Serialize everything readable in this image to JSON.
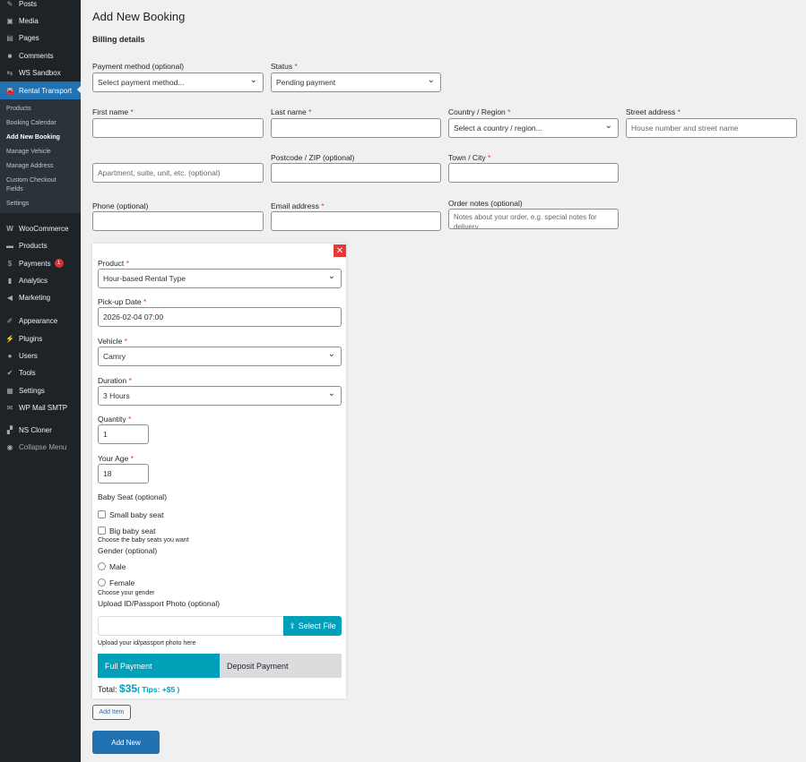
{
  "sidebar": {
    "items": [
      {
        "label": "Posts",
        "icon": "pin-icon"
      },
      {
        "label": "Media",
        "icon": "media-icon"
      },
      {
        "label": "Pages",
        "icon": "pages-icon"
      },
      {
        "label": "Comments",
        "icon": "comment-icon"
      },
      {
        "label": "WS Sandbox",
        "icon": "sandbox-icon"
      },
      {
        "label": "Rental Transport",
        "icon": "car-icon"
      }
    ],
    "submenu": [
      "Products",
      "Booking Calendar",
      "Add New Booking",
      "Manage Vehicle",
      "Manage Address",
      "Custom Checkout Fields",
      "Settings"
    ],
    "items2": [
      {
        "label": "WooCommerce",
        "icon": "woo-icon"
      },
      {
        "label": "Products",
        "icon": "archive-icon"
      },
      {
        "label": "Payments",
        "icon": "dollar-icon",
        "badge": "1"
      },
      {
        "label": "Analytics",
        "icon": "chart-icon"
      },
      {
        "label": "Marketing",
        "icon": "megaphone-icon"
      },
      {
        "label": "Appearance",
        "icon": "brush-icon"
      },
      {
        "label": "Plugins",
        "icon": "plugin-icon"
      },
      {
        "label": "Users",
        "icon": "user-icon"
      },
      {
        "label": "Tools",
        "icon": "wrench-icon"
      },
      {
        "label": "Settings",
        "icon": "settings-icon"
      },
      {
        "label": "WP Mail SMTP",
        "icon": "mail-icon"
      },
      {
        "label": "NS Cloner",
        "icon": "cloner-icon"
      },
      {
        "label": "Collapse Menu",
        "icon": "collapse-icon"
      }
    ]
  },
  "page": {
    "title": "Add New Booking",
    "section": "Billing details"
  },
  "billing": {
    "payment_method": {
      "label": "Payment method (optional)",
      "value": "Select payment method..."
    },
    "status": {
      "label": "Status",
      "value": "Pending payment"
    },
    "first_name": {
      "label": "First name"
    },
    "last_name": {
      "label": "Last name"
    },
    "country": {
      "label": "Country / Region",
      "value": "Select a country / region..."
    },
    "street": {
      "label": "Street address",
      "placeholder": "House number and street name"
    },
    "apartment": {
      "placeholder": "Apartment, suite, unit, etc. (optional)"
    },
    "postcode": {
      "label": "Postcode / ZIP (optional)"
    },
    "city": {
      "label": "Town / City"
    },
    "phone": {
      "label": "Phone (optional)"
    },
    "email": {
      "label": "Email address"
    },
    "notes": {
      "label": "Order notes (optional)",
      "placeholder": "Notes about your order, e.g. special notes for delivery."
    }
  },
  "item": {
    "product": {
      "label": "Product",
      "value": "Hour-based Rental Type"
    },
    "pickup": {
      "label": "Pick-up Date",
      "value": "2026-02-04 07:00"
    },
    "vehicle": {
      "label": "Vehicle",
      "value": "Camry"
    },
    "duration": {
      "label": "Duration",
      "value": "3 Hours"
    },
    "quantity": {
      "label": "Quantity",
      "value": "1"
    },
    "age": {
      "label": "Your Age",
      "value": "18"
    },
    "baby_seat": {
      "label": "Baby Seat (optional)",
      "options": [
        "Small baby seat",
        "Big baby seat"
      ],
      "help": "Choose the baby seats you want"
    },
    "gender": {
      "label": "Gender (optional)",
      "options": [
        "Male",
        "Female"
      ],
      "help": "Choose your gender"
    },
    "upload": {
      "label": "Upload ID/Passport Photo (optional)",
      "button": "Select File",
      "help": "Upload your id/passport photo here"
    },
    "payment_tabs": [
      "Full Payment",
      "Deposit Payment"
    ],
    "total_label": "Total:",
    "total": "$35",
    "tips": "( Tips: +$5 )"
  },
  "actions": {
    "add_item": "Add Item",
    "add_new": "Add New"
  },
  "required_mark": "*"
}
